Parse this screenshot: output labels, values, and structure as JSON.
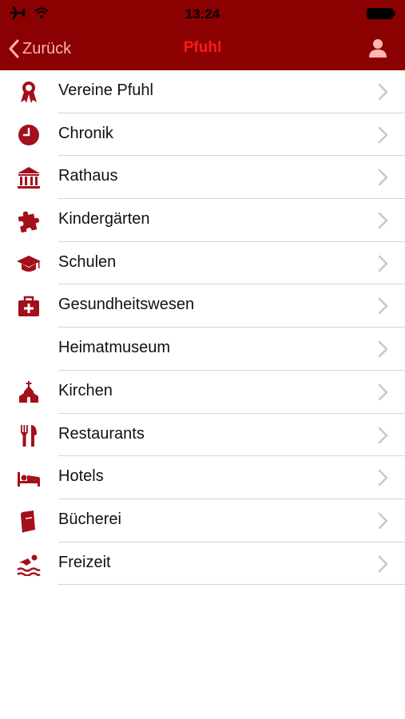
{
  "status": {
    "time": "13:24",
    "icons": [
      "airplane-icon",
      "wifi-icon",
      "battery-icon"
    ]
  },
  "nav": {
    "back_label": "Zurück",
    "title": "Pfuhl",
    "profile_icon": "user-icon"
  },
  "colors": {
    "header": "#8b0000",
    "accent": "#a30f1b",
    "title": "#ff1a1a",
    "back": "#ffb3b3"
  },
  "items": [
    {
      "label": "Vereine Pfuhl",
      "icon": "award-icon"
    },
    {
      "label": "Chronik",
      "icon": "clock-icon"
    },
    {
      "label": "Rathaus",
      "icon": "townhall-icon"
    },
    {
      "label": "Kindergärten",
      "icon": "puzzle-icon"
    },
    {
      "label": "Schulen",
      "icon": "graduation-cap-icon"
    },
    {
      "label": "Gesundheitswesen",
      "icon": "medical-kit-icon"
    },
    {
      "label": "Heimatmuseum",
      "icon": ""
    },
    {
      "label": "Kirchen",
      "icon": "church-icon"
    },
    {
      "label": "Restaurants",
      "icon": "cutlery-icon"
    },
    {
      "label": "Hotels",
      "icon": "bed-icon"
    },
    {
      "label": "Bücherei",
      "icon": "book-icon"
    },
    {
      "label": "Freizeit",
      "icon": "swimmer-icon"
    }
  ]
}
